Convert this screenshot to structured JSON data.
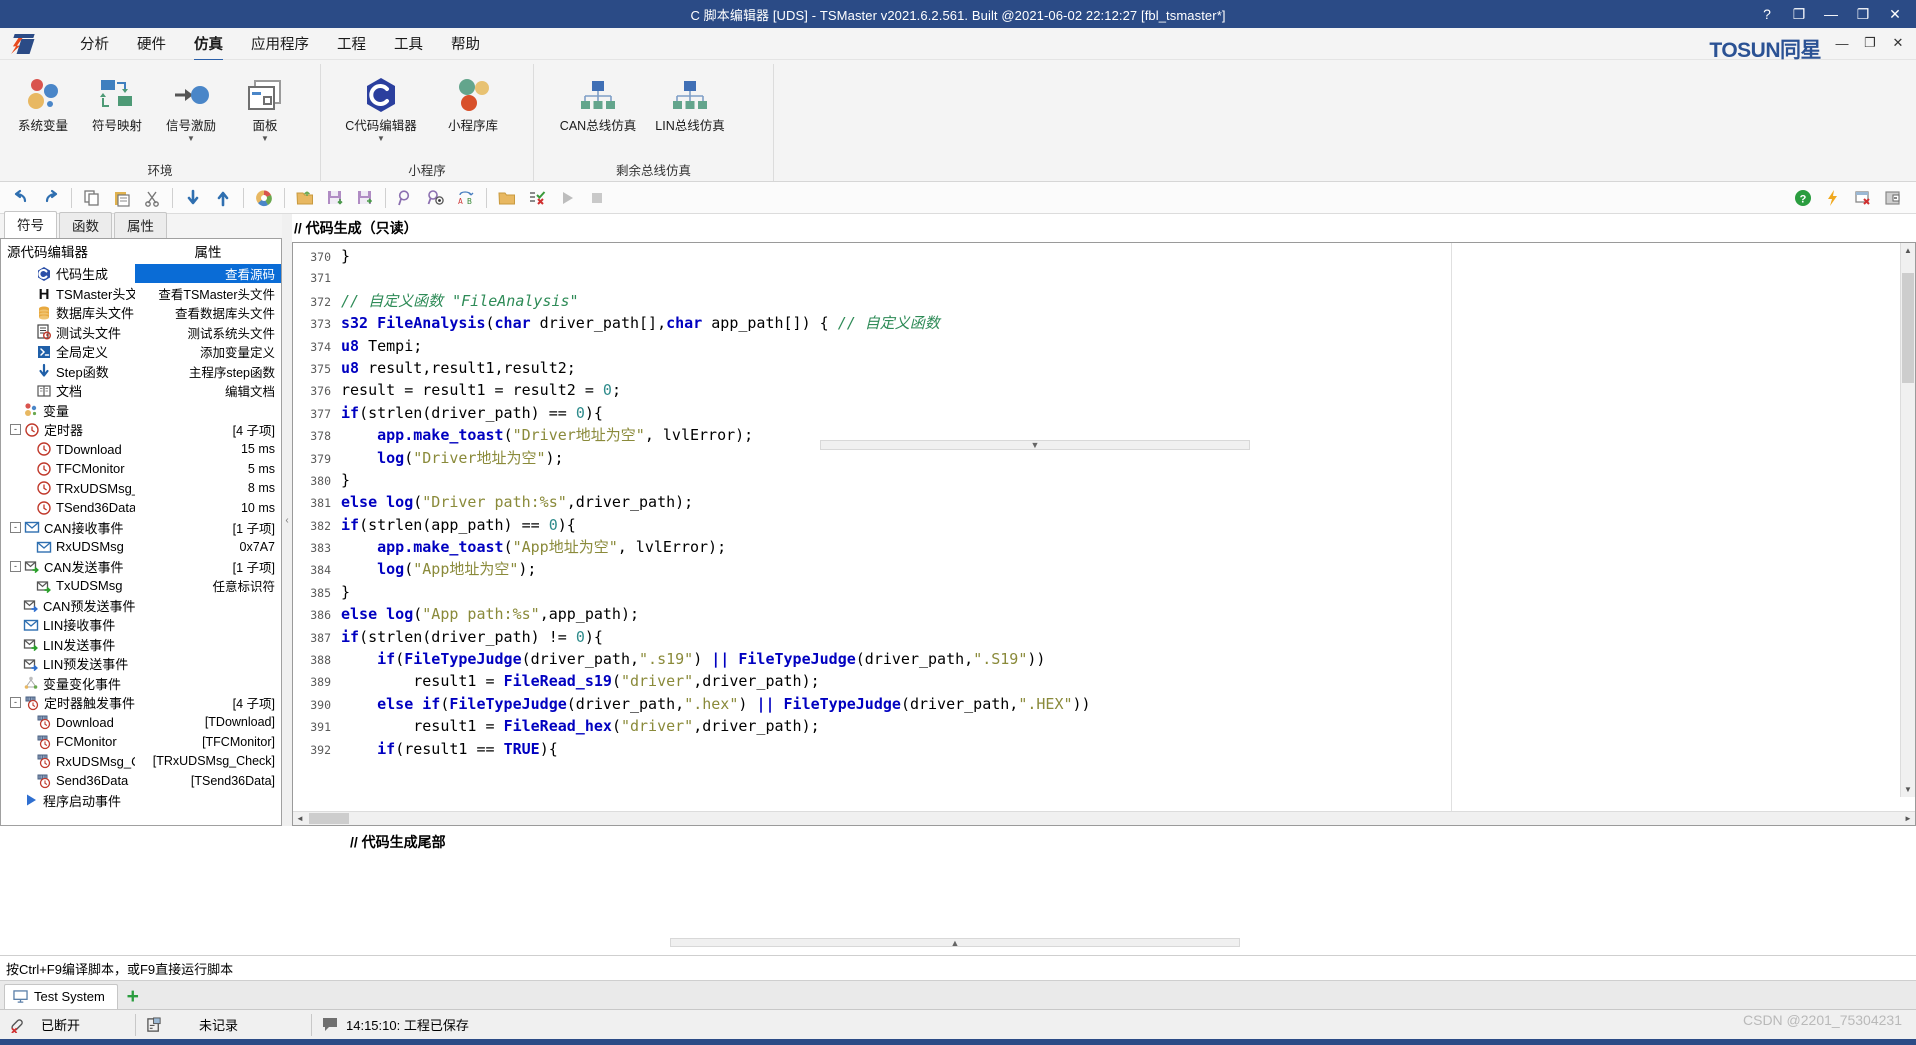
{
  "window": {
    "title": "C 脚本编辑器 [UDS] - TSMaster v2021.6.2.561. Built @2021-06-02 22:12:27 [fbl_tsmaster*]",
    "help_btn": "?",
    "restore_btn": "❐",
    "minimize_btn": "—",
    "maximize_btn": "❐",
    "close_btn": "✕"
  },
  "menubar": {
    "brand": "TOSUN同星",
    "items": [
      {
        "label": "分析",
        "active": false
      },
      {
        "label": "硬件",
        "active": false
      },
      {
        "label": "仿真",
        "active": true
      },
      {
        "label": "应用程序",
        "active": false
      },
      {
        "label": "工程",
        "active": false
      },
      {
        "label": "工具",
        "active": false
      },
      {
        "label": "帮助",
        "active": false
      }
    ],
    "inner_minimize": "—",
    "inner_restore": "❐",
    "inner_close": "✕"
  },
  "ribbon": {
    "groups": [
      {
        "label": "环境",
        "buttons": [
          {
            "label": "系统变量",
            "icon": "system-variable-icon",
            "caret": ""
          },
          {
            "label": "符号映射",
            "icon": "symbol-mapping-icon",
            "caret": ""
          },
          {
            "label": "信号激励",
            "icon": "signal-stimulus-icon",
            "caret": "▼"
          },
          {
            "label": "面板",
            "icon": "panel-icon",
            "caret": "▼"
          }
        ]
      },
      {
        "label": "小程序",
        "buttons": [
          {
            "label": "C代码编辑器",
            "icon": "c-code-editor-icon",
            "caret": "▼"
          },
          {
            "label": "小程序库",
            "icon": "mini-program-library-icon",
            "caret": ""
          }
        ]
      },
      {
        "label": "剩余总线仿真",
        "buttons": [
          {
            "label": "CAN总线仿真",
            "icon": "can-bus-simulation-icon",
            "caret": ""
          },
          {
            "label": "LIN总线仿真",
            "icon": "lin-bus-simulation-icon",
            "caret": ""
          }
        ]
      }
    ]
  },
  "toolstrip": {
    "left_icons": [
      "undo-icon",
      "redo-icon",
      "sep",
      "copy-icon",
      "paste-icon",
      "cut-icon",
      "sep",
      "move-down-icon",
      "move-up-icon",
      "sep",
      "color-wheel-icon",
      "sep",
      "open-file-icon",
      "save-icon",
      "save-as-icon",
      "sep",
      "find-icon",
      "find-next-icon",
      "replace-icon",
      "sep",
      "open-folder-icon",
      "compile-icon",
      "run-icon",
      "stop-icon"
    ],
    "right_icons": [
      "help-icon",
      "flash-icon",
      "close-window-icon",
      "restore-window-icon"
    ]
  },
  "leftpane": {
    "tabs": [
      {
        "label": "符号",
        "active": true
      },
      {
        "label": "函数",
        "active": false
      },
      {
        "label": "属性",
        "active": false
      }
    ],
    "header": {
      "name": "源代码编辑器",
      "prop": "属性"
    },
    "tree": [
      {
        "name": "代码生成",
        "prop": "查看源码",
        "icon": "code-generate-icon",
        "depth": 1,
        "selected": true,
        "expander": ""
      },
      {
        "name": "TSMaster头文件",
        "prop": "查看TSMaster头文件",
        "icon": "header-file-icon",
        "depth": 1,
        "selected": false,
        "expander": ""
      },
      {
        "name": "数据库头文件",
        "prop": "查看数据库头文件",
        "icon": "database-header-icon",
        "depth": 1,
        "selected": false,
        "expander": ""
      },
      {
        "name": "测试头文件",
        "prop": "测试系统头文件",
        "icon": "test-header-icon",
        "depth": 1,
        "selected": false,
        "expander": ""
      },
      {
        "name": "全局定义",
        "prop": "添加变量定义",
        "icon": "global-define-icon",
        "depth": 1,
        "selected": false,
        "expander": ""
      },
      {
        "name": "Step函数",
        "prop": "主程序step函数",
        "icon": "step-function-icon",
        "depth": 1,
        "selected": false,
        "expander": ""
      },
      {
        "name": "文档",
        "prop": "编辑文档",
        "icon": "document-icon",
        "depth": 1,
        "selected": false,
        "expander": ""
      },
      {
        "name": "变量",
        "prop": "",
        "icon": "variable-icon",
        "depth": 0,
        "selected": false,
        "expander": ""
      },
      {
        "name": "定时器",
        "prop": "[4 子项]",
        "icon": "timer-icon",
        "depth": 0,
        "selected": false,
        "expander": "-"
      },
      {
        "name": "TDownload",
        "prop": "15 ms",
        "icon": "timer-icon",
        "depth": 1,
        "selected": false,
        "expander": ""
      },
      {
        "name": "TFCMonitor",
        "prop": "5 ms",
        "icon": "timer-icon",
        "depth": 1,
        "selected": false,
        "expander": ""
      },
      {
        "name": "TRxUDSMsg_Ch",
        "prop": "8 ms",
        "icon": "timer-icon",
        "depth": 1,
        "selected": false,
        "expander": ""
      },
      {
        "name": "TSend36Data",
        "prop": "10 ms",
        "icon": "timer-icon",
        "depth": 1,
        "selected": false,
        "expander": ""
      },
      {
        "name": "CAN接收事件",
        "prop": "[1 子项]",
        "icon": "can-receive-icon",
        "depth": 0,
        "selected": false,
        "expander": "-"
      },
      {
        "name": "RxUDSMsg",
        "prop": "0x7A7",
        "icon": "can-receive-icon",
        "depth": 1,
        "selected": false,
        "expander": ""
      },
      {
        "name": "CAN发送事件",
        "prop": "[1 子项]",
        "icon": "can-send-icon",
        "depth": 0,
        "selected": false,
        "expander": "-"
      },
      {
        "name": "TxUDSMsg",
        "prop": "任意标识符",
        "icon": "can-send-icon",
        "depth": 1,
        "selected": false,
        "expander": ""
      },
      {
        "name": "CAN预发送事件",
        "prop": "",
        "icon": "can-presend-icon",
        "depth": 0,
        "selected": false,
        "expander": ""
      },
      {
        "name": "LIN接收事件",
        "prop": "",
        "icon": "lin-receive-icon",
        "depth": 0,
        "selected": false,
        "expander": ""
      },
      {
        "name": "LIN发送事件",
        "prop": "",
        "icon": "lin-send-icon",
        "depth": 0,
        "selected": false,
        "expander": ""
      },
      {
        "name": "LIN预发送事件",
        "prop": "",
        "icon": "lin-presend-icon",
        "depth": 0,
        "selected": false,
        "expander": ""
      },
      {
        "name": "变量变化事件",
        "prop": "",
        "icon": "variable-change-icon",
        "depth": 0,
        "selected": false,
        "expander": ""
      },
      {
        "name": "定时器触发事件",
        "prop": "[4 子项]",
        "icon": "timer-trigger-icon",
        "depth": 0,
        "selected": false,
        "expander": "-"
      },
      {
        "name": "Download",
        "prop": "[TDownload]",
        "icon": "timer-trigger-icon",
        "depth": 1,
        "selected": false,
        "expander": ""
      },
      {
        "name": "FCMonitor",
        "prop": "[TFCMonitor]",
        "icon": "timer-trigger-icon",
        "depth": 1,
        "selected": false,
        "expander": ""
      },
      {
        "name": "RxUDSMsg_Che",
        "prop": "[TRxUDSMsg_Check]",
        "icon": "timer-trigger-icon",
        "depth": 1,
        "selected": false,
        "expander": ""
      },
      {
        "name": "Send36Data",
        "prop": "[TSend36Data]",
        "icon": "timer-trigger-icon",
        "depth": 1,
        "selected": false,
        "expander": ""
      },
      {
        "name": "程序启动事件",
        "prop": "",
        "icon": "program-start-icon",
        "depth": 0,
        "selected": false,
        "expander": ""
      }
    ]
  },
  "editor": {
    "header": "// 代码生成（只读）",
    "footer": "// 代码生成尾部",
    "first_line_number": 370,
    "lines": [
      {
        "n": 370,
        "tokens": [
          {
            "t": "}",
            "c": "plain"
          }
        ]
      },
      {
        "n": 371,
        "tokens": []
      },
      {
        "n": 372,
        "tokens": [
          {
            "t": "// 自定义函数 \"FileAnalysis\"",
            "c": "cmt"
          }
        ]
      },
      {
        "n": 373,
        "tokens": [
          {
            "t": "s32 FileAnalysis",
            "c": "kw"
          },
          {
            "t": "(",
            "c": "plain"
          },
          {
            "t": "char",
            "c": "kw"
          },
          {
            "t": " driver_path[],",
            "c": "plain"
          },
          {
            "t": "char",
            "c": "kw"
          },
          {
            "t": " app_path[]) { ",
            "c": "plain"
          },
          {
            "t": "// 自定义函数",
            "c": "cmt"
          }
        ]
      },
      {
        "n": 374,
        "tokens": [
          {
            "t": "u8",
            "c": "kw"
          },
          {
            "t": " Tempi;",
            "c": "plain"
          }
        ]
      },
      {
        "n": 375,
        "tokens": [
          {
            "t": "u8",
            "c": "kw"
          },
          {
            "t": " result,result1,result2;",
            "c": "plain"
          }
        ]
      },
      {
        "n": 376,
        "tokens": [
          {
            "t": "result = result1 = result2 = ",
            "c": "plain"
          },
          {
            "t": "0",
            "c": "num"
          },
          {
            "t": ";",
            "c": "plain"
          }
        ]
      },
      {
        "n": 377,
        "tokens": [
          {
            "t": "if",
            "c": "kw"
          },
          {
            "t": "(strlen(driver_path) == ",
            "c": "plain"
          },
          {
            "t": "0",
            "c": "num"
          },
          {
            "t": "){",
            "c": "plain"
          }
        ]
      },
      {
        "n": 378,
        "tokens": [
          {
            "t": "    ",
            "c": "plain"
          },
          {
            "t": "app.make_toast",
            "c": "kw"
          },
          {
            "t": "(",
            "c": "plain"
          },
          {
            "t": "\"Driver地址为空\"",
            "c": "str"
          },
          {
            "t": ", lvlError);",
            "c": "plain"
          }
        ]
      },
      {
        "n": 379,
        "tokens": [
          {
            "t": "    ",
            "c": "plain"
          },
          {
            "t": "log",
            "c": "kw"
          },
          {
            "t": "(",
            "c": "plain"
          },
          {
            "t": "\"Driver地址为空\"",
            "c": "str"
          },
          {
            "t": ");",
            "c": "plain"
          }
        ]
      },
      {
        "n": 380,
        "tokens": [
          {
            "t": "}",
            "c": "plain"
          }
        ]
      },
      {
        "n": 381,
        "tokens": [
          {
            "t": "else log",
            "c": "kw"
          },
          {
            "t": "(",
            "c": "plain"
          },
          {
            "t": "\"Driver path:%s\"",
            "c": "str"
          },
          {
            "t": ",driver_path);",
            "c": "plain"
          }
        ]
      },
      {
        "n": 382,
        "tokens": [
          {
            "t": "if",
            "c": "kw"
          },
          {
            "t": "(strlen(app_path) == ",
            "c": "plain"
          },
          {
            "t": "0",
            "c": "num"
          },
          {
            "t": "){",
            "c": "plain"
          }
        ]
      },
      {
        "n": 383,
        "tokens": [
          {
            "t": "    ",
            "c": "plain"
          },
          {
            "t": "app.make_toast",
            "c": "kw"
          },
          {
            "t": "(",
            "c": "plain"
          },
          {
            "t": "\"App地址为空\"",
            "c": "str"
          },
          {
            "t": ", lvlError);",
            "c": "plain"
          }
        ]
      },
      {
        "n": 384,
        "tokens": [
          {
            "t": "    ",
            "c": "plain"
          },
          {
            "t": "log",
            "c": "kw"
          },
          {
            "t": "(",
            "c": "plain"
          },
          {
            "t": "\"App地址为空\"",
            "c": "str"
          },
          {
            "t": ");",
            "c": "plain"
          }
        ]
      },
      {
        "n": 385,
        "tokens": [
          {
            "t": "}",
            "c": "plain"
          }
        ]
      },
      {
        "n": 386,
        "tokens": [
          {
            "t": "else log",
            "c": "kw"
          },
          {
            "t": "(",
            "c": "plain"
          },
          {
            "t": "\"App path:%s\"",
            "c": "str"
          },
          {
            "t": ",app_path);",
            "c": "plain"
          }
        ]
      },
      {
        "n": 387,
        "tokens": [
          {
            "t": "if",
            "c": "kw"
          },
          {
            "t": "(strlen(driver_path) != ",
            "c": "plain"
          },
          {
            "t": "0",
            "c": "num"
          },
          {
            "t": "){",
            "c": "plain"
          }
        ]
      },
      {
        "n": 388,
        "tokens": [
          {
            "t": "    ",
            "c": "plain"
          },
          {
            "t": "if",
            "c": "kw"
          },
          {
            "t": "(",
            "c": "plain"
          },
          {
            "t": "FileTypeJudge",
            "c": "kw"
          },
          {
            "t": "(driver_path,",
            "c": "plain"
          },
          {
            "t": "\".s19\"",
            "c": "str"
          },
          {
            "t": ") ",
            "c": "plain"
          },
          {
            "t": "||",
            "c": "kw"
          },
          {
            "t": " ",
            "c": "plain"
          },
          {
            "t": "FileTypeJudge",
            "c": "kw"
          },
          {
            "t": "(driver_path,",
            "c": "plain"
          },
          {
            "t": "\".S19\"",
            "c": "str"
          },
          {
            "t": "))",
            "c": "plain"
          }
        ]
      },
      {
        "n": 389,
        "tokens": [
          {
            "t": "        result1 = ",
            "c": "plain"
          },
          {
            "t": "FileRead_s19",
            "c": "kw"
          },
          {
            "t": "(",
            "c": "plain"
          },
          {
            "t": "\"driver\"",
            "c": "str"
          },
          {
            "t": ",driver_path);",
            "c": "plain"
          }
        ]
      },
      {
        "n": 390,
        "tokens": [
          {
            "t": "    ",
            "c": "plain"
          },
          {
            "t": "else if",
            "c": "kw"
          },
          {
            "t": "(",
            "c": "plain"
          },
          {
            "t": "FileTypeJudge",
            "c": "kw"
          },
          {
            "t": "(driver_path,",
            "c": "plain"
          },
          {
            "t": "\".hex\"",
            "c": "str"
          },
          {
            "t": ") ",
            "c": "plain"
          },
          {
            "t": "||",
            "c": "kw"
          },
          {
            "t": " ",
            "c": "plain"
          },
          {
            "t": "FileTypeJudge",
            "c": "kw"
          },
          {
            "t": "(driver_path,",
            "c": "plain"
          },
          {
            "t": "\".HEX\"",
            "c": "str"
          },
          {
            "t": "))",
            "c": "plain"
          }
        ]
      },
      {
        "n": 391,
        "tokens": [
          {
            "t": "        result1 = ",
            "c": "plain"
          },
          {
            "t": "FileRead_hex",
            "c": "kw"
          },
          {
            "t": "(",
            "c": "plain"
          },
          {
            "t": "\"driver\"",
            "c": "str"
          },
          {
            "t": ",driver_path);",
            "c": "plain"
          }
        ]
      },
      {
        "n": 392,
        "tokens": [
          {
            "t": "    ",
            "c": "plain"
          },
          {
            "t": "if",
            "c": "kw"
          },
          {
            "t": "(result1 == ",
            "c": "plain"
          },
          {
            "t": "TRUE",
            "c": "kw"
          },
          {
            "t": "){",
            "c": "plain"
          }
        ]
      }
    ]
  },
  "hintbar": {
    "text": "按Ctrl+F9编译脚本，或F9直接运行脚本"
  },
  "bottomtabs": {
    "tabs": [
      {
        "label": "Test System",
        "icon": "monitor-icon"
      }
    ],
    "add_label": "+"
  },
  "statusbar": {
    "connection": {
      "icon": "disconnected-icon",
      "text": "已断开"
    },
    "record": {
      "icon": "record-icon",
      "text": "未记录"
    },
    "message": {
      "icon": "message-icon",
      "text": "14:15:10: 工程已保存"
    }
  },
  "watermark": {
    "text": "CSDN @2201_75304231"
  },
  "colors": {
    "titlebar": "#2b4b86",
    "accent": "#2b5fa8",
    "selection": "#0a6cd6",
    "comment": "#2e8b57",
    "keyword": "#0000c0",
    "string": "#8a8a3a",
    "number": "#2e8b8b"
  }
}
